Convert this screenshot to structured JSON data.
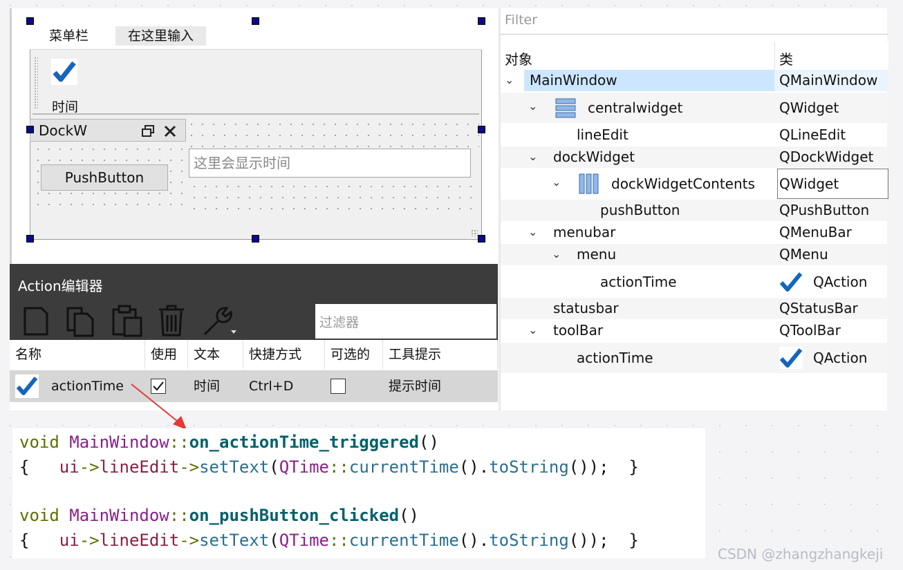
{
  "designer": {
    "menubar": {
      "items": [
        "菜单栏",
        "在这里输入"
      ]
    },
    "toolbar": {
      "action_label": "时间",
      "action_icon": "checkmark-icon"
    },
    "dock": {
      "title": "DockW",
      "float_icon": "restore-icon",
      "close_icon": "close-icon"
    },
    "push_button_label": "PushButton",
    "line_edit_placeholder": "这里会显示时间"
  },
  "action_editor": {
    "title": "Action编辑器",
    "filter_placeholder": "过滤器",
    "toolbar_icons": [
      "new-action-icon",
      "copy-icon",
      "paste-icon",
      "delete-icon",
      "configure-icon"
    ],
    "columns": [
      "名称",
      "使用",
      "文本",
      "快捷方式",
      "可选的",
      "工具提示"
    ],
    "rows": [
      {
        "name": "actionTime",
        "used": true,
        "text": "时间",
        "shortcut": "Ctrl+D",
        "checkable": false,
        "tooltip": "提示时间"
      }
    ]
  },
  "object_inspector": {
    "filter_placeholder": "Filter",
    "columns": [
      "对象",
      "类"
    ],
    "rows": [
      {
        "name": "MainWindow",
        "class": "QMainWindow"
      },
      {
        "name": "centralwidget",
        "class": "QWidget"
      },
      {
        "name": "lineEdit",
        "class": "QLineEdit"
      },
      {
        "name": "dockWidget",
        "class": "QDockWidget"
      },
      {
        "name": "dockWidgetContents",
        "class": "QWidget"
      },
      {
        "name": "pushButton",
        "class": "QPushButton"
      },
      {
        "name": "menubar",
        "class": "QMenuBar"
      },
      {
        "name": "menu",
        "class": "QMenu"
      },
      {
        "name": "actionTime",
        "class": "QAction"
      },
      {
        "name": "statusbar",
        "class": "QStatusBar"
      },
      {
        "name": "toolBar",
        "class": "QToolBar"
      },
      {
        "name": "actionTime",
        "class": "QAction"
      }
    ]
  },
  "code": {
    "l1": {
      "kw": "void ",
      "cls": "MainWindow",
      "sep": "::",
      "fn": "on_actionTime_triggered",
      "tail": "()"
    },
    "l2": {
      "a": "{   ",
      "ui": "ui",
      "arr1": "->",
      "le": "lineEdit",
      "arr2": "->",
      "st": "setText",
      "p1": "(",
      "qt": "QTime",
      "sep": "::",
      "ct": "currentTime",
      "p2": "().",
      "ts": "toString",
      "end": "());  }"
    },
    "l3": {
      "kw": "void ",
      "cls": "MainWindow",
      "sep": "::",
      "fn": "on_pushButton_clicked",
      "tail": "()"
    },
    "l4": {
      "a": "{   ",
      "ui": "ui",
      "arr1": "->",
      "le": "lineEdit",
      "arr2": "->",
      "st": "setText",
      "p1": "(",
      "qt": "QTime",
      "sep": "::",
      "ct": "currentTime",
      "p2": "().",
      "ts": "toString",
      "end": "());  }"
    }
  },
  "colors": {
    "accent_check": "#1565c0",
    "arrow_red": "#e53935",
    "selection": "#cce6ff"
  },
  "watermark": "CSDN @zhangzhangkeji"
}
